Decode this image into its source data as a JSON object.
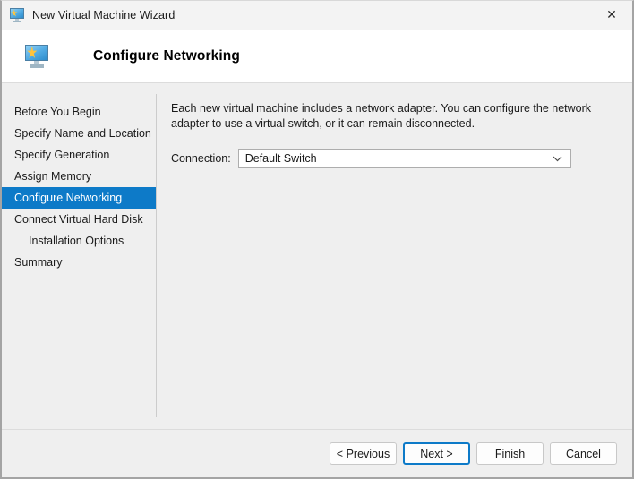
{
  "titlebar": {
    "title": "New Virtual Machine Wizard",
    "icon": "virtual-machine-monitor-icon",
    "close_label": "✕"
  },
  "header": {
    "title": "Configure Networking",
    "icon": "virtual-machine-monitor-icon"
  },
  "sidebar": {
    "items": [
      {
        "label": "Before You Begin",
        "active": false,
        "sub": false
      },
      {
        "label": "Specify Name and Location",
        "active": false,
        "sub": false
      },
      {
        "label": "Specify Generation",
        "active": false,
        "sub": false
      },
      {
        "label": "Assign Memory",
        "active": false,
        "sub": false
      },
      {
        "label": "Configure Networking",
        "active": true,
        "sub": false
      },
      {
        "label": "Connect Virtual Hard Disk",
        "active": false,
        "sub": false
      },
      {
        "label": "Installation Options",
        "active": false,
        "sub": true
      },
      {
        "label": "Summary",
        "active": false,
        "sub": false
      }
    ]
  },
  "content": {
    "description": "Each new virtual machine includes a network adapter. You can configure the network adapter to use a virtual switch, or it can remain disconnected.",
    "connection_label": "Connection:",
    "connection_value": "Default Switch"
  },
  "footer": {
    "buttons": [
      {
        "label": "< Previous",
        "default": false
      },
      {
        "label": "Next >",
        "default": true
      },
      {
        "label": "Finish",
        "default": false
      },
      {
        "label": "Cancel",
        "default": false
      }
    ]
  },
  "colors": {
    "accent": "#0d7ac8",
    "window_bg": "#efefef",
    "header_bg": "#ffffff",
    "titlebar_bg": "#f3f3f3"
  }
}
